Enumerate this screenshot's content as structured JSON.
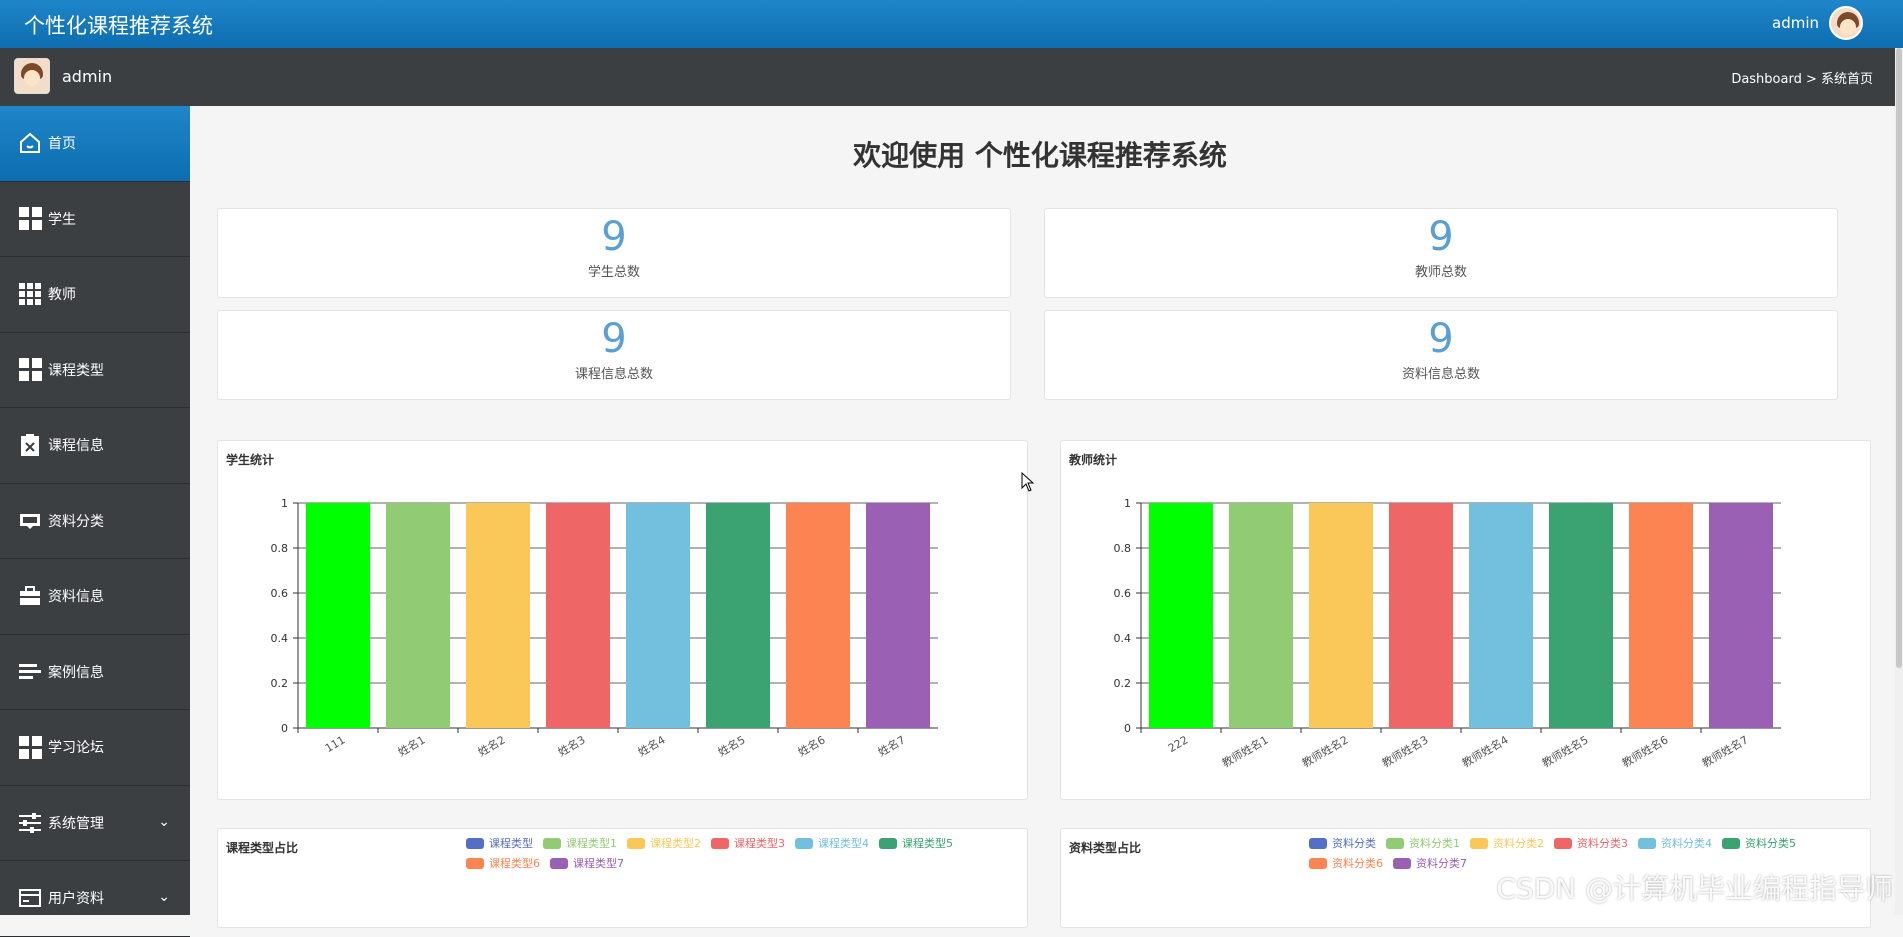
{
  "header": {
    "title": "个性化课程推荐系统",
    "username": "admin"
  },
  "subbar": {
    "username": "admin",
    "breadcrumb": "Dashboard > 系统首页"
  },
  "sidebar": {
    "items": [
      {
        "label": "首页",
        "icon": "home-icon",
        "active": true
      },
      {
        "label": "学生",
        "icon": "grid-icon"
      },
      {
        "label": "教师",
        "icon": "apps-icon"
      },
      {
        "label": "课程类型",
        "icon": "grid-icon"
      },
      {
        "label": "课程信息",
        "icon": "clipboard-icon"
      },
      {
        "label": "资料分类",
        "icon": "inbox-icon"
      },
      {
        "label": "资料信息",
        "icon": "briefcase-icon"
      },
      {
        "label": "案例信息",
        "icon": "list-icon"
      },
      {
        "label": "学习论坛",
        "icon": "grid-icon"
      },
      {
        "label": "系统管理",
        "icon": "sliders-icon",
        "expandable": true
      },
      {
        "label": "用户资料",
        "icon": "card-icon",
        "expandable": true
      }
    ]
  },
  "main": {
    "welcome": "欢迎使用 个性化课程推荐系统",
    "stats": [
      {
        "value": "9",
        "label": "学生总数"
      },
      {
        "value": "9",
        "label": "教师总数"
      },
      {
        "value": "9",
        "label": "课程信息总数"
      },
      {
        "value": "9",
        "label": "资料信息总数"
      }
    ]
  },
  "colors": [
    "#00ff00",
    "#91cc75",
    "#fac858",
    "#ee6666",
    "#73c0de",
    "#3ba272",
    "#fc8452",
    "#9a60b4"
  ],
  "legend_colors": [
    "#5470c6",
    "#91cc75",
    "#fac858",
    "#ee6666",
    "#73c0de",
    "#3ba272",
    "#fc8452",
    "#9a60b4"
  ],
  "chart_data": [
    {
      "type": "bar",
      "title": "学生统计",
      "categories": [
        "111",
        "姓名1",
        "姓名2",
        "姓名3",
        "姓名4",
        "姓名5",
        "姓名6",
        "姓名7"
      ],
      "values": [
        1,
        1,
        1,
        1,
        1,
        1,
        1,
        1
      ],
      "ylim": [
        0,
        1
      ],
      "yticks": [
        "0",
        "0.2",
        "0.4",
        "0.6",
        "0.8",
        "1"
      ],
      "grid": true
    },
    {
      "type": "bar",
      "title": "教师统计",
      "categories": [
        "222",
        "教师姓名1",
        "教师姓名2",
        "教师姓名3",
        "教师姓名4",
        "教师姓名5",
        "教师姓名6",
        "教师姓名7"
      ],
      "values": [
        1,
        1,
        1,
        1,
        1,
        1,
        1,
        1
      ],
      "ylim": [
        0,
        1
      ],
      "yticks": [
        "0",
        "0.2",
        "0.4",
        "0.6",
        "0.8",
        "1"
      ],
      "grid": true
    },
    {
      "type": "pie",
      "title": "课程类型占比",
      "legend": [
        "课程类型",
        "课程类型1",
        "课程类型2",
        "课程类型3",
        "课程类型4",
        "课程类型5",
        "课程类型6",
        "课程类型7"
      ]
    },
    {
      "type": "pie",
      "title": "资料类型占比",
      "legend": [
        "资料分类",
        "资料分类1",
        "资料分类2",
        "资料分类3",
        "资料分类4",
        "资料分类5",
        "资料分类6",
        "资料分类7"
      ]
    }
  ],
  "watermark": "CSDN @计算机毕业编程指导师"
}
